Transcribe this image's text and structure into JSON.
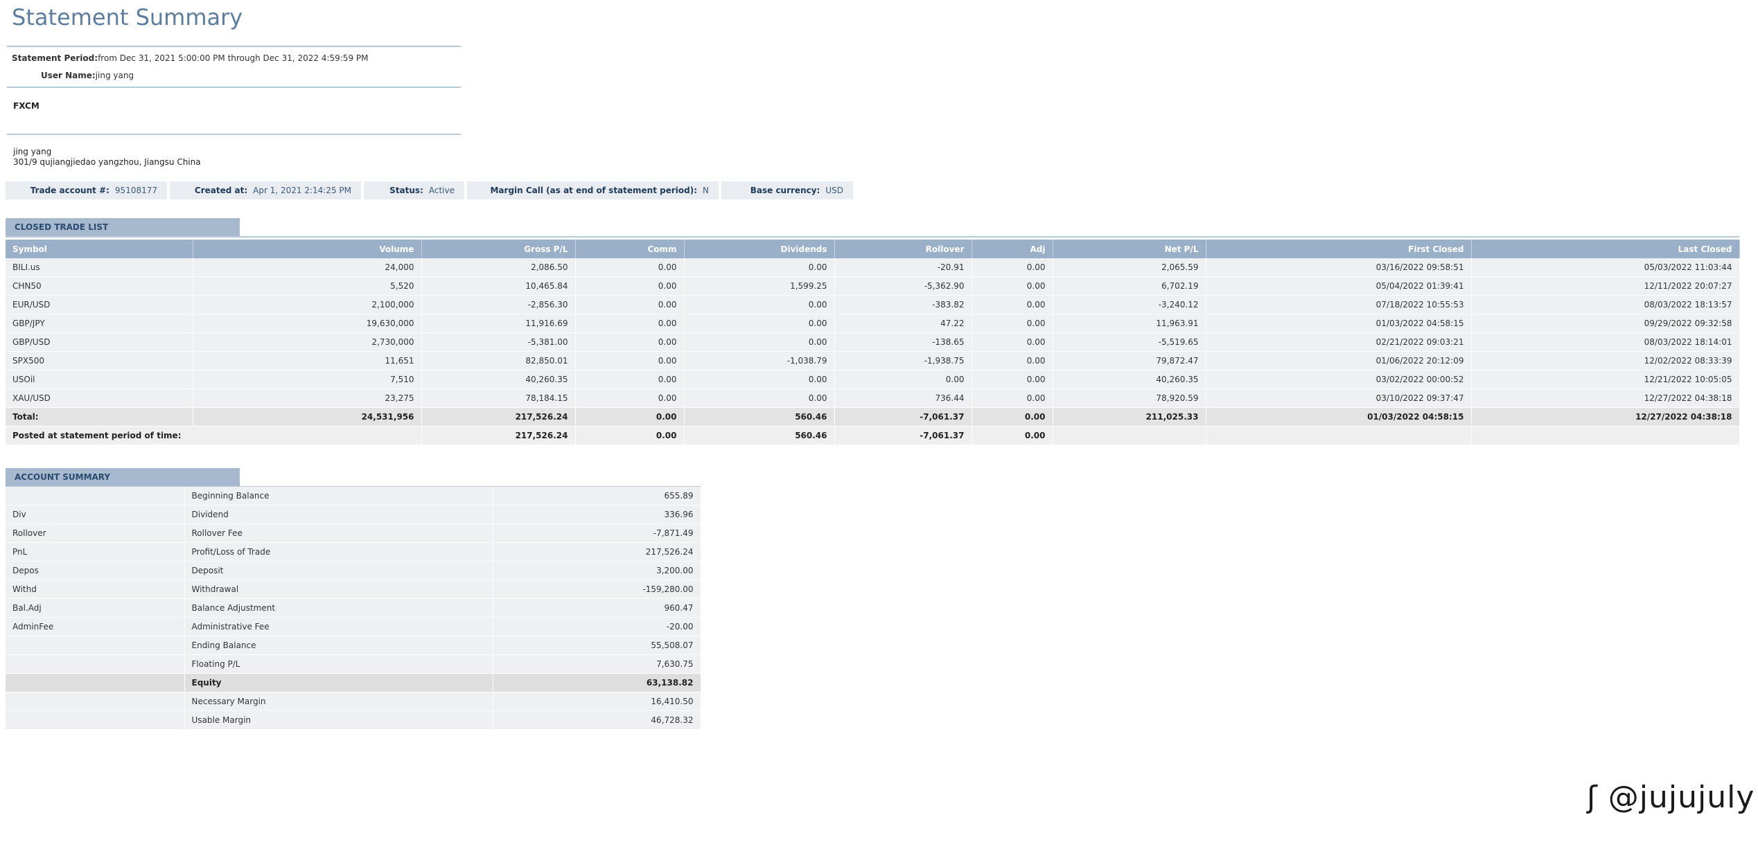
{
  "header": {
    "title": "Statement Summary",
    "period_label": "Statement Period:",
    "period_value": "from Dec 31, 2021 5:00:00 PM through Dec 31, 2022 4:59:59 PM",
    "user_label": "User Name:",
    "user_value": "jing yang",
    "broker": "FXCM",
    "address_name": "jing yang",
    "address_line": "301/9 qujiangjiedao yangzhou, Jiangsu China"
  },
  "account_bar": [
    {
      "label": "Trade account #:",
      "value": "95108177"
    },
    {
      "label": "Created at:",
      "value": "Apr 1, 2021 2:14:25 PM"
    },
    {
      "label": "Status:",
      "value": "Active"
    },
    {
      "label": "Margin Call (as at end of statement period):",
      "value": "N"
    },
    {
      "label": "Base currency:",
      "value": "USD"
    }
  ],
  "closed_trades": {
    "section_title": "CLOSED TRADE LIST",
    "columns": [
      "Symbol",
      "Volume",
      "Gross P/L",
      "Comm",
      "Dividends",
      "Rollover",
      "Adj",
      "Net P/L",
      "First Closed",
      "Last Closed"
    ],
    "rows": [
      [
        "BILI.us",
        "24,000",
        "2,086.50",
        "0.00",
        "0.00",
        "-20.91",
        "0.00",
        "2,065.59",
        "03/16/2022 09:58:51",
        "05/03/2022 11:03:44"
      ],
      [
        "CHN50",
        "5,520",
        "10,465.84",
        "0.00",
        "1,599.25",
        "-5,362.90",
        "0.00",
        "6,702.19",
        "05/04/2022 01:39:41",
        "12/11/2022 20:07:27"
      ],
      [
        "EUR/USD",
        "2,100,000",
        "-2,856.30",
        "0.00",
        "0.00",
        "-383.82",
        "0.00",
        "-3,240.12",
        "07/18/2022 10:55:53",
        "08/03/2022 18:13:57"
      ],
      [
        "GBP/JPY",
        "19,630,000",
        "11,916.69",
        "0.00",
        "0.00",
        "47.22",
        "0.00",
        "11,963.91",
        "01/03/2022 04:58:15",
        "09/29/2022 09:32:58"
      ],
      [
        "GBP/USD",
        "2,730,000",
        "-5,381.00",
        "0.00",
        "0.00",
        "-138.65",
        "0.00",
        "-5,519.65",
        "02/21/2022 09:03:21",
        "08/03/2022 18:14:01"
      ],
      [
        "SPX500",
        "11,651",
        "82,850.01",
        "0.00",
        "-1,038.79",
        "-1,938.75",
        "0.00",
        "79,872.47",
        "01/06/2022 20:12:09",
        "12/02/2022 08:33:39"
      ],
      [
        "USOil",
        "7,510",
        "40,260.35",
        "0.00",
        "0.00",
        "0.00",
        "0.00",
        "40,260.35",
        "03/02/2022 00:00:52",
        "12/21/2022 10:05:05"
      ],
      [
        "XAU/USD",
        "23,275",
        "78,184.15",
        "0.00",
        "0.00",
        "736.44",
        "0.00",
        "78,920.59",
        "03/10/2022 09:37:47",
        "12/27/2022 04:38:18"
      ]
    ],
    "total": [
      "Total:",
      "24,531,956",
      "217,526.24",
      "0.00",
      "560.46",
      "-7,061.37",
      "0.00",
      "211,025.33",
      "01/03/2022 04:58:15",
      "12/27/2022 04:38:18"
    ],
    "posted": {
      "label": "Posted at statement period of time:",
      "values": [
        "217,526.24",
        "0.00",
        "560.46",
        "-7,061.37",
        "0.00"
      ]
    }
  },
  "account_summary": {
    "section_title": "ACCOUNT SUMMARY",
    "rows": [
      {
        "code": "",
        "desc": "Beginning Balance",
        "amount": "655.89"
      },
      {
        "code": "Div",
        "desc": "Dividend",
        "amount": "336.96"
      },
      {
        "code": "Rollover",
        "desc": "Rollover Fee",
        "amount": "-7,871.49"
      },
      {
        "code": "PnL",
        "desc": "Profit/Loss of Trade",
        "amount": "217,526.24"
      },
      {
        "code": "Depos",
        "desc": "Deposit",
        "amount": "3,200.00"
      },
      {
        "code": "Withd",
        "desc": "Withdrawal",
        "amount": "-159,280.00"
      },
      {
        "code": "Bal.Adj",
        "desc": "Balance Adjustment",
        "amount": "960.47"
      },
      {
        "code": "AdminFee",
        "desc": "Administrative Fee",
        "amount": "-20.00"
      },
      {
        "code": "",
        "desc": "Ending Balance",
        "amount": "55,508.07"
      },
      {
        "code": "",
        "desc": "Floating P/L",
        "amount": "7,630.75"
      },
      {
        "code": "",
        "desc": "Equity",
        "amount": "63,138.82"
      },
      {
        "code": "",
        "desc": "Necessary Margin",
        "amount": "16,410.50"
      },
      {
        "code": "",
        "desc": "Usable Margin",
        "amount": "46,728.32"
      }
    ]
  },
  "watermark": "@jujujuly"
}
